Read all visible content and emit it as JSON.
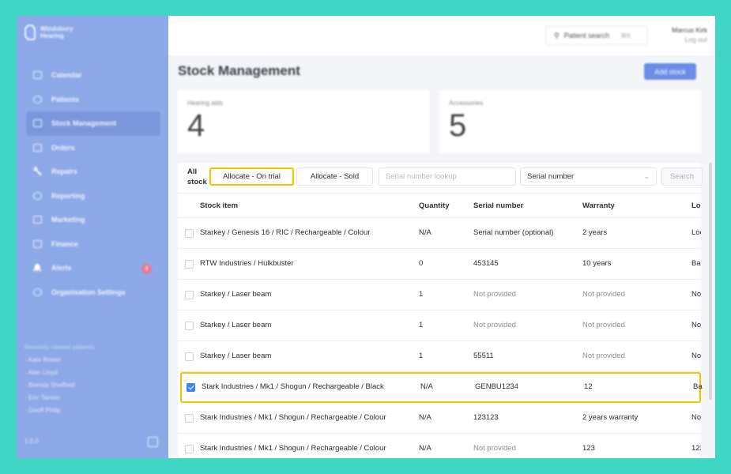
{
  "sidebar": {
    "brand": "Windsbury Hearing",
    "nav": [
      {
        "label": "Calendar",
        "icon": "calendar-icon"
      },
      {
        "label": "Patients",
        "icon": "patients-icon"
      },
      {
        "label": "Stock Management",
        "icon": "clipboard-icon"
      },
      {
        "label": "Orders",
        "icon": "orders-icon"
      },
      {
        "label": "Repairs",
        "icon": "wrench-icon"
      },
      {
        "label": "Reporting",
        "icon": "chart-icon"
      },
      {
        "label": "Marketing",
        "icon": "mail-icon"
      },
      {
        "label": "Finance",
        "icon": "card-icon"
      },
      {
        "label": "Alerts",
        "icon": "bell-icon",
        "badge": "3"
      },
      {
        "label": "Organisation Settings",
        "icon": "gear-icon"
      }
    ],
    "recent_header": "Recently viewed patients",
    "recent": [
      "- Kate Bower",
      "- Alan Lloyd",
      "- Brenda Sheffield",
      "- Eric Tanner",
      "- Geoff Philip"
    ],
    "version": "1.0.0"
  },
  "header": {
    "search_label": "Patient search",
    "search_shortcut": "⌘K",
    "user_name": "Marcus Kirk",
    "logout": "Log out"
  },
  "page": {
    "title": "Stock Management",
    "add_button": "Add stock",
    "stats": [
      {
        "label": "Hearing aids",
        "value": "4"
      },
      {
        "label": "Accessories",
        "value": "5"
      }
    ]
  },
  "filters": {
    "all_stock_line1": "All",
    "all_stock_line2": "stock",
    "btn_on_trial": "Allocate - On trial",
    "btn_sold": "Allocate - Sold",
    "lookup_placeholder": "Serial number lookup",
    "select_value": "Serial number",
    "search_btn": "Search"
  },
  "table": {
    "headers": [
      "Stock item",
      "Quantity",
      "Serial number",
      "Warranty",
      "Lo"
    ],
    "rows": [
      {
        "item": "Starkey / Genesis 16 / RIC / Rechargeable / Colour",
        "qty": "N/A",
        "serial": "Serial number (optional)",
        "warranty": "2 years",
        "loc": "Loc",
        "checked": false
      },
      {
        "item": "RTW Industries / Hulkbuster",
        "qty": "0",
        "serial": "453145",
        "warranty": "10 years",
        "loc": "Ba",
        "checked": false
      },
      {
        "item": "Starkey / Laser beam",
        "qty": "1",
        "serial": "Not provided",
        "warranty": "Not provided",
        "loc": "No",
        "checked": false
      },
      {
        "item": "Starkey / Laser beam",
        "qty": "1",
        "serial": "Not provided",
        "warranty": "Not provided",
        "loc": "No",
        "checked": false
      },
      {
        "item": "Starkey / Laser beam",
        "qty": "1",
        "serial": "55511",
        "warranty": "Not provided",
        "loc": "No",
        "checked": false
      },
      {
        "item": "Stark Industries / Mk1 / Shogun / Rechargeable / Black",
        "qty": "N/A",
        "serial": "GENBU1234",
        "warranty": "12",
        "loc": "Ba",
        "checked": true
      },
      {
        "item": "Stark Industries / Mk1 / Shogun / Rechargeable / Colour",
        "qty": "N/A",
        "serial": "123123",
        "warranty": "2 years warranty",
        "loc": "No",
        "checked": false
      },
      {
        "item": "Stark Industries / Mk1 / Shogun / Rechargeable / Colour",
        "qty": "N/A",
        "serial": "Not provided",
        "warranty": "123",
        "loc": "123",
        "checked": false
      }
    ]
  }
}
